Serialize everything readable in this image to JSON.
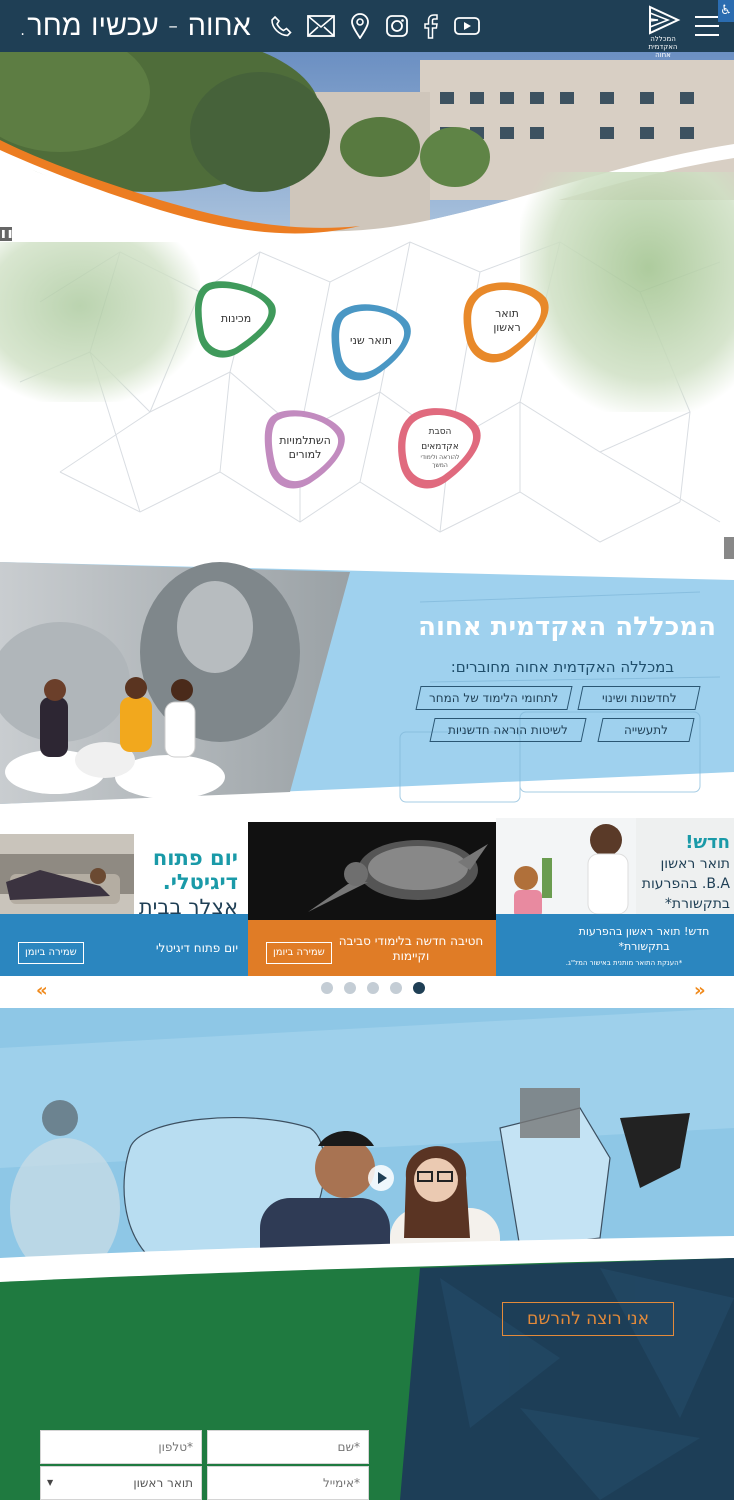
{
  "header": {
    "tagline": "אחוה - עכשיו מחר.",
    "logo_lines": [
      "המכללה",
      "האקדמית",
      "אחוה"
    ],
    "icons": [
      "phone-icon",
      "mail-icon",
      "location-icon",
      "instagram-icon",
      "facebook-icon",
      "youtube-icon"
    ]
  },
  "hero": {
    "bubbles": [
      {
        "label": "מכינות",
        "color": "#3f9a5b"
      },
      {
        "label": "תואר שני",
        "color": "#4a97c4"
      },
      {
        "label": "תואר ראשון",
        "color": "#e8892a"
      },
      {
        "label": "השתלמויות למורים",
        "color": "#c28bbf"
      },
      {
        "label": "הסבת אקדמאים",
        "sub": "להוראה ולימודי המשך",
        "color": "#e06a7e"
      }
    ]
  },
  "about": {
    "title": "המכללה האקדמית אחוה",
    "subtitle": "במכללה האקדמית אחוה מחוברים:",
    "chips": [
      "לחדשנות ושינוי",
      "לתחומי הלימוד של המחר",
      "לתעשייה",
      "לשיטות הוראה חדשניות"
    ]
  },
  "carousel": {
    "slides": [
      {
        "headline_lines": [
          "חדש!",
          "תואר ראשון",
          "B.A. בהפרעות",
          "בתקשורת*"
        ],
        "caption": "חדש! תואר ראשון בהפרעות בתקשורת*",
        "note": "*הענקת התואר מותנית באישור המל\"ג.",
        "color": "#2b86bf"
      },
      {
        "caption": "חטיבה חדשה בלימודי סביבה וקיימות",
        "button": "שמירה ביומן",
        "color": "#e07c26"
      },
      {
        "headline_lines": [
          "יום פתוח",
          "דיגיטלי.",
          "אצלך בבית"
        ],
        "caption": "יום פתוח דיגיטלי",
        "button": "שמירה ביומן",
        "color": "#2b86bf"
      }
    ],
    "dots": 5,
    "active_dot": 5,
    "prev": "«",
    "next": "»"
  },
  "register": {
    "button": "אני רוצה להרשם",
    "fields": {
      "name": "*שם",
      "phone": "*טלפון",
      "email": "*אימייל",
      "degree": "תואר ראשון"
    }
  }
}
